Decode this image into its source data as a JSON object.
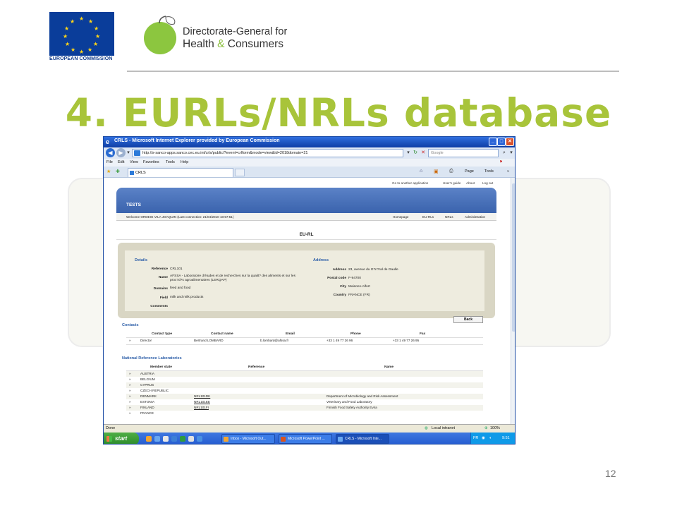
{
  "slide": {
    "eu_caption": "EUROPEAN COMMISSION",
    "dg_line1": "Directorate-General for",
    "dg_line2a": "Health ",
    "dg_line2amp": "&",
    "dg_line2b": " Consumers",
    "title": "4. EURLs/NRLs database",
    "page_number": "12"
  },
  "browser": {
    "title": "CRLS - Microsoft Internet Explorer provided by European Commission",
    "address": "http://s-sanco-apps.sanco.cec.eu.int/crls/public/?event=crlform&mode=view&id=2018domain=21",
    "search_placeholder": "Google",
    "menu": [
      "File",
      "Edit",
      "View",
      "Favorites",
      "Tools",
      "Help"
    ],
    "tab_label": "CRLS",
    "toolbar": {
      "page": "Page",
      "tools": "Tools"
    },
    "status": {
      "left": "Done",
      "zone": "Local intranet",
      "zoom": "100%"
    }
  },
  "app": {
    "top_links": [
      "Go to another application",
      "User's guide",
      "About",
      "Log out"
    ],
    "banner_title": "TESTS",
    "welcome": "Welcome ORDEIG VILA JOAQUIN (Last connection: 21/04/2010 10:57:51)",
    "nav": [
      "Homepage",
      "EU-RLs",
      "NRLs",
      "Administration"
    ],
    "section_title": "EU-RL",
    "details": {
      "heading": "Details",
      "reference_label": "Reference",
      "reference": "CRL101",
      "name_label": "Name",
      "name": "AFSSA - Laboratoire d'études et de recherches sur la qualit? des aliments et sur les proc?d?s agroalimentaires (LERQAP)",
      "domains_label": "Domains",
      "domains": "feed and food",
      "field_label": "Field",
      "field": "milk and milk products",
      "comments_label": "Comments"
    },
    "address": {
      "heading": "Address",
      "address_label": "Address",
      "address": "23, avenue du G?n?ral de Gaulle",
      "postal_label": "Postal code",
      "postal": "F-94700",
      "city_label": "City",
      "city": "Maisons-Alfort",
      "country_label": "Country",
      "country": "FRANCE (FR)"
    },
    "back_label": "Back",
    "contacts": {
      "heading": "Contacts",
      "headers": [
        "Contact type",
        "Contact name",
        "Email",
        "Phone",
        "Fax"
      ],
      "rows": [
        {
          "bullet": "»",
          "type": "Director",
          "name": "Bertrand LOMBARD",
          "email": "b.lombard@afssa.fr",
          "phone": "+33 1 49 77 26 96",
          "fax": "+33 1 49 77 26 95"
        }
      ]
    },
    "nrl": {
      "heading": "National Reference Laboratories",
      "headers": [
        "Member state",
        "Reference",
        "Name"
      ],
      "rows": [
        {
          "bullet": "»",
          "state": "AUSTRIA",
          "ref": "",
          "name": ""
        },
        {
          "bullet": "»",
          "state": "BELGIUM",
          "ref": "",
          "name": ""
        },
        {
          "bullet": "»",
          "state": "CYPRUS",
          "ref": "",
          "name": ""
        },
        {
          "bullet": "»",
          "state": "CZECH REPUBLIC",
          "ref": "",
          "name": ""
        },
        {
          "bullet": "»",
          "state": "DENMARK",
          "ref": "NRL101DK",
          "name": "Department of Microbiology and Risk Assessment"
        },
        {
          "bullet": "»",
          "state": "ESTONIA",
          "ref": "NRL101EE",
          "name": "Veterinary and Food Laboratory"
        },
        {
          "bullet": "»",
          "state": "FINLAND",
          "ref": "NRL101FI",
          "name": "Finnish Food Safety Authority Evira"
        },
        {
          "bullet": "»",
          "state": "FRANCE",
          "ref": "",
          "name": ""
        }
      ]
    }
  },
  "taskbar": {
    "start": "start",
    "items": [
      "Inbox - Microsoft Out...",
      "Microsoft PowerPoint ...",
      "CRLS - Microsoft Inte..."
    ],
    "lang": "FR",
    "clock": "9:51"
  },
  "colors": {
    "title_green": "#a8c43a",
    "xp_blue": "#245bd0",
    "link_blue": "#2c5ea8"
  }
}
